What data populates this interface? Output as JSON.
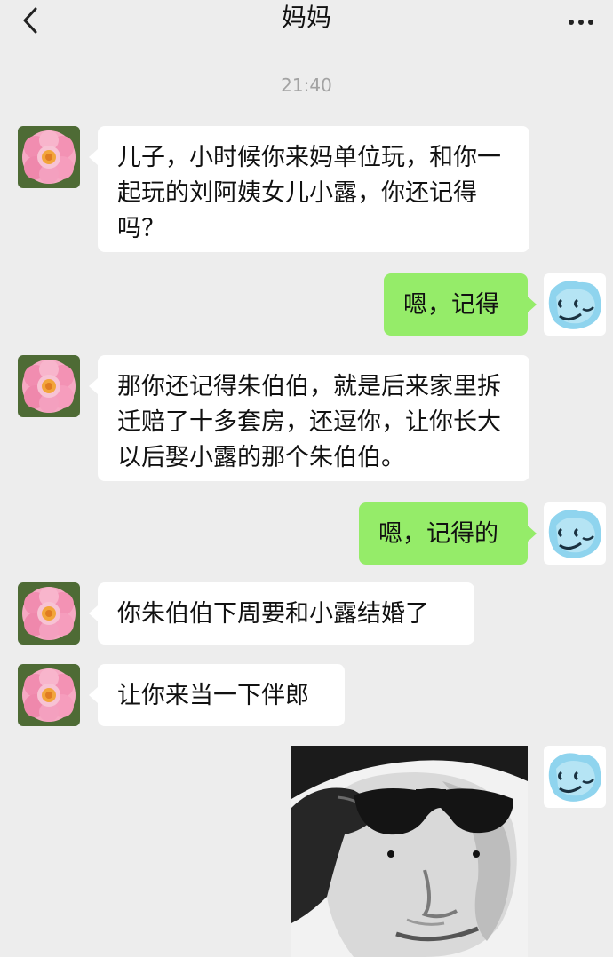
{
  "header": {
    "title": "妈妈",
    "back_icon": "chevron-left-icon",
    "more_icon": "more-horizontal-icon"
  },
  "timestamp": "21:40",
  "messages": [
    {
      "side": "left",
      "sender": "mom",
      "text": "儿子，小时候你来妈单位玩，和你一起玩的刘阿姨女儿小露，你还记得吗？"
    },
    {
      "side": "right",
      "sender": "me",
      "text": "嗯，记得"
    },
    {
      "side": "left",
      "sender": "mom",
      "text": "那你还记得朱伯伯，就是后来家里拆迁赔了十多套房，还逗你，让你长大以后娶小露的那个朱伯伯。"
    },
    {
      "side": "right",
      "sender": "me",
      "text": "嗯，记得的"
    },
    {
      "side": "left",
      "sender": "mom",
      "text": "你朱伯伯下周要和小露结婚了"
    },
    {
      "side": "left",
      "sender": "mom",
      "text": "让你来当一下伴郎"
    },
    {
      "side": "right",
      "sender": "me",
      "type": "sticker",
      "sticker": "sunglasses-saluting-meme-face"
    }
  ],
  "avatars": {
    "mom": "pink-peony-flower-avatar",
    "me": "blue-smiley-doodle-avatar"
  },
  "colors": {
    "background": "#ededed",
    "incoming_bubble": "#ffffff",
    "outgoing_bubble": "#95ec69",
    "timestamp_text": "#a3a3a3"
  }
}
